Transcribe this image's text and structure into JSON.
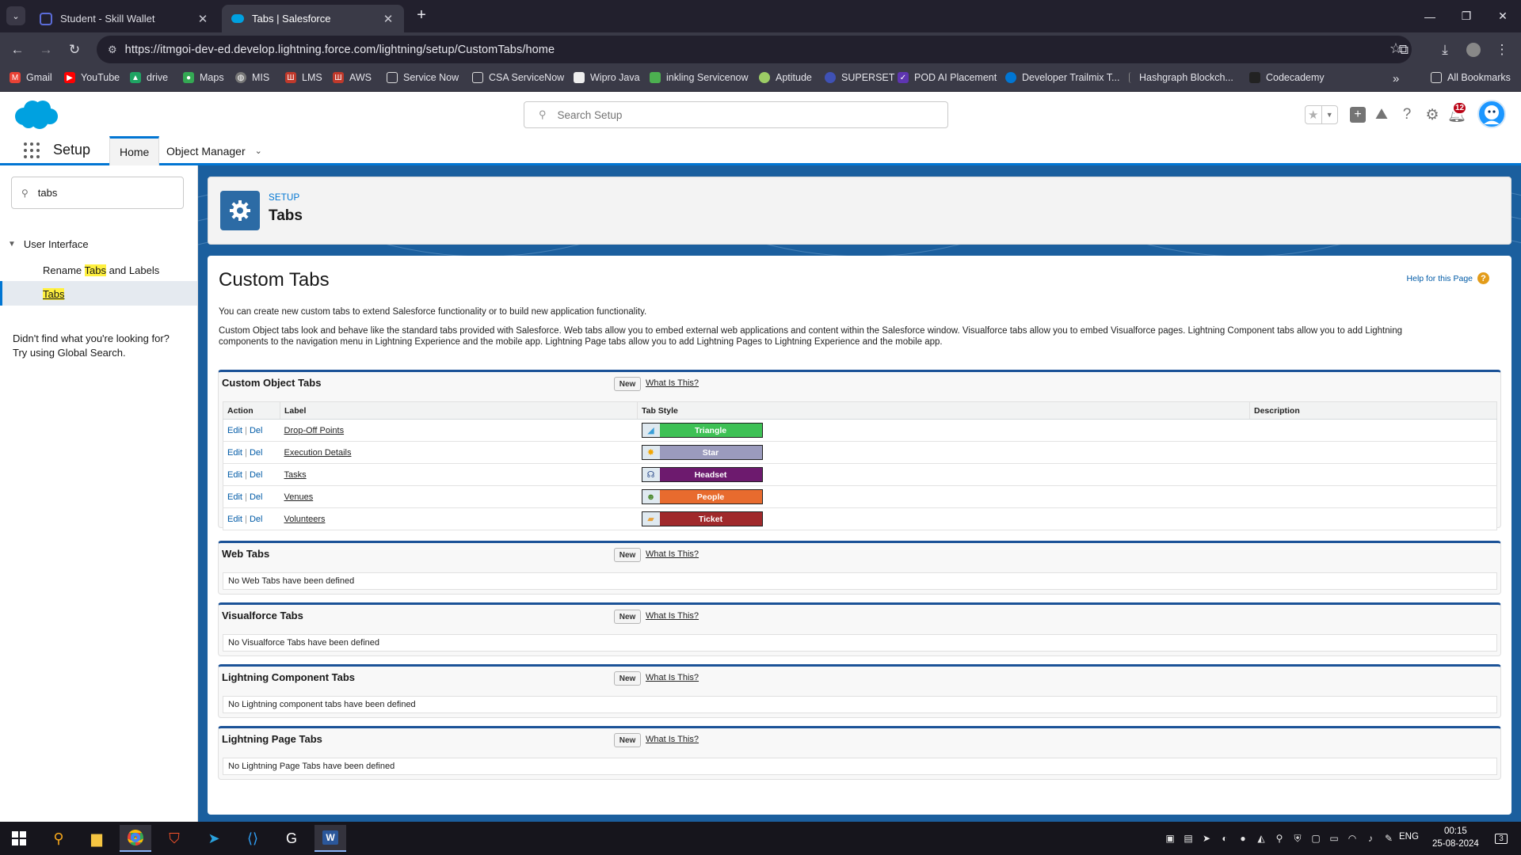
{
  "browser": {
    "tabs": [
      {
        "title": "Student - Skill Wallet",
        "active": false
      },
      {
        "title": "Tabs | Salesforce",
        "active": true
      }
    ],
    "url": "https://itmgoi-dev-ed.develop.lightning.force.com/lightning/setup/CustomTabs/home",
    "bookmarks": [
      "Gmail",
      "YouTube",
      "drive",
      "Maps",
      "MIS",
      "LMS",
      "AWS",
      "Service Now",
      "CSA ServiceNow",
      "Wipro Java",
      "inkling Servicenow",
      "Aptitude",
      "SUPERSET",
      "POD AI Placement",
      "Developer Trailmix T...",
      "Hashgraph Blockch...",
      "Codecademy"
    ],
    "all_bookmarks": "All Bookmarks",
    "more_bookmarks": "»"
  },
  "header": {
    "search_placeholder": "Search Setup",
    "notification_count": "12",
    "brand_color": "#00a1e0"
  },
  "nav": {
    "app_name": "Setup",
    "tabs": [
      "Home",
      "Object Manager"
    ]
  },
  "sidebar": {
    "quick_find_value": "tabs",
    "group": "User Interface",
    "item1_pre": "Rename ",
    "item1_mark": "Tabs",
    "item1_post": " and Labels",
    "item2": "Tabs",
    "hint1": "Didn't find what you're looking for?",
    "hint2": "Try using Global Search."
  },
  "page": {
    "breadcrumb": "SETUP",
    "title": "Tabs",
    "heading": "Custom Tabs",
    "help_link": "Help for this Page",
    "intro": "You can create new custom tabs to extend Salesforce functionality or to build new application functionality.",
    "description_line1": "Custom Object tabs look and behave like the standard tabs provided with Salesforce. Web tabs allow you to embed external web applications and content within the Salesforce window. Visualforce tabs allow you to embed Visualforce pages. Lightning Component tabs allow you to add Lightning",
    "description_line2": "components to the navigation menu in Lightning Experience and the mobile app. Lightning Page tabs allow you to add Lightning Pages to Lightning Experience and the mobile app."
  },
  "sections": {
    "new_label": "New",
    "what_label": "What Is This?",
    "custom_object": {
      "title": "Custom Object Tabs",
      "columns": [
        "Action",
        "Label",
        "Tab Style",
        "Description"
      ],
      "edit": "Edit",
      "sep": "|",
      "del": "Del",
      "rows": [
        {
          "label": "Drop-Off Points",
          "style": "Triangle",
          "color": "#3ec155",
          "icon": "triangle-icon"
        },
        {
          "label": "Execution Details",
          "style": "Star",
          "color": "#9b9bbd",
          "icon": "star-icon"
        },
        {
          "label": "Tasks",
          "style": "Headset",
          "color": "#6d1a6e",
          "icon": "headset-icon"
        },
        {
          "label": "Venues",
          "style": "People",
          "color": "#e86b2e",
          "icon": "people-icon"
        },
        {
          "label": "Volunteers",
          "style": "Ticket",
          "color": "#a0292b",
          "icon": "ticket-icon"
        }
      ]
    },
    "web": {
      "title": "Web Tabs",
      "empty": "No Web Tabs have been defined"
    },
    "visualforce": {
      "title": "Visualforce Tabs",
      "empty": "No Visualforce Tabs have been defined"
    },
    "lightning_component": {
      "title": "Lightning Component Tabs",
      "empty": "No Lightning component tabs have been defined"
    },
    "lightning_page": {
      "title": "Lightning Page Tabs",
      "empty": "No Lightning Page Tabs have been defined"
    }
  },
  "taskbar": {
    "lang": "ENG",
    "time": "00:15",
    "date": "25-08-2024",
    "notif": "3"
  }
}
